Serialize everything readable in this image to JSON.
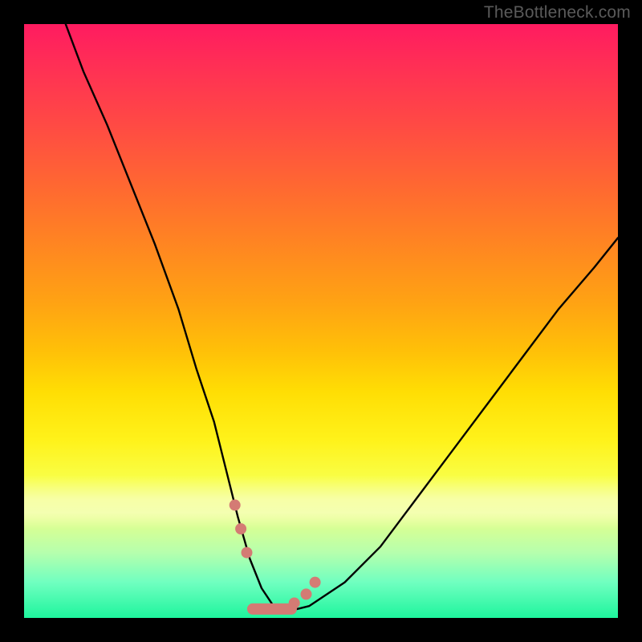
{
  "watermark": "TheBottleneck.com",
  "chart_data": {
    "type": "line",
    "title": "",
    "xlabel": "",
    "ylabel": "",
    "xlim": [
      0,
      100
    ],
    "ylim": [
      0,
      100
    ],
    "series": [
      {
        "name": "bottleneck-curve",
        "x": [
          7,
          10,
          14,
          18,
          22,
          26,
          29,
          32,
          34,
          36,
          38,
          40,
          42,
          44,
          48,
          54,
          60,
          66,
          72,
          78,
          84,
          90,
          96,
          100
        ],
        "values": [
          100,
          92,
          83,
          73,
          63,
          52,
          42,
          33,
          25,
          17,
          10,
          5,
          2,
          1,
          2,
          6,
          12,
          20,
          28,
          36,
          44,
          52,
          59,
          64
        ]
      }
    ],
    "markers": {
      "name": "curve-dots",
      "color": "#d47b74",
      "points": [
        {
          "x": 35.5,
          "y": 19
        },
        {
          "x": 36.5,
          "y": 15
        },
        {
          "x": 37.5,
          "y": 11
        },
        {
          "x": 45.5,
          "y": 2.5
        },
        {
          "x": 47.5,
          "y": 4
        },
        {
          "x": 49.0,
          "y": 6
        }
      ]
    },
    "bottom_segment": {
      "name": "curve-floor-segment",
      "color": "#d47b74",
      "x": [
        38.5,
        45.0
      ],
      "y": [
        1.5,
        1.5
      ]
    },
    "background": {
      "type": "vertical-gradient",
      "stops": [
        {
          "pos": 0.0,
          "color": "#ff1b60"
        },
        {
          "pos": 0.17,
          "color": "#ff4a44"
        },
        {
          "pos": 0.38,
          "color": "#ff8820"
        },
        {
          "pos": 0.55,
          "color": "#ffc008"
        },
        {
          "pos": 0.7,
          "color": "#fff21a"
        },
        {
          "pos": 0.89,
          "color": "#b6ffad"
        },
        {
          "pos": 1.0,
          "color": "#1ef59d"
        }
      ]
    }
  }
}
